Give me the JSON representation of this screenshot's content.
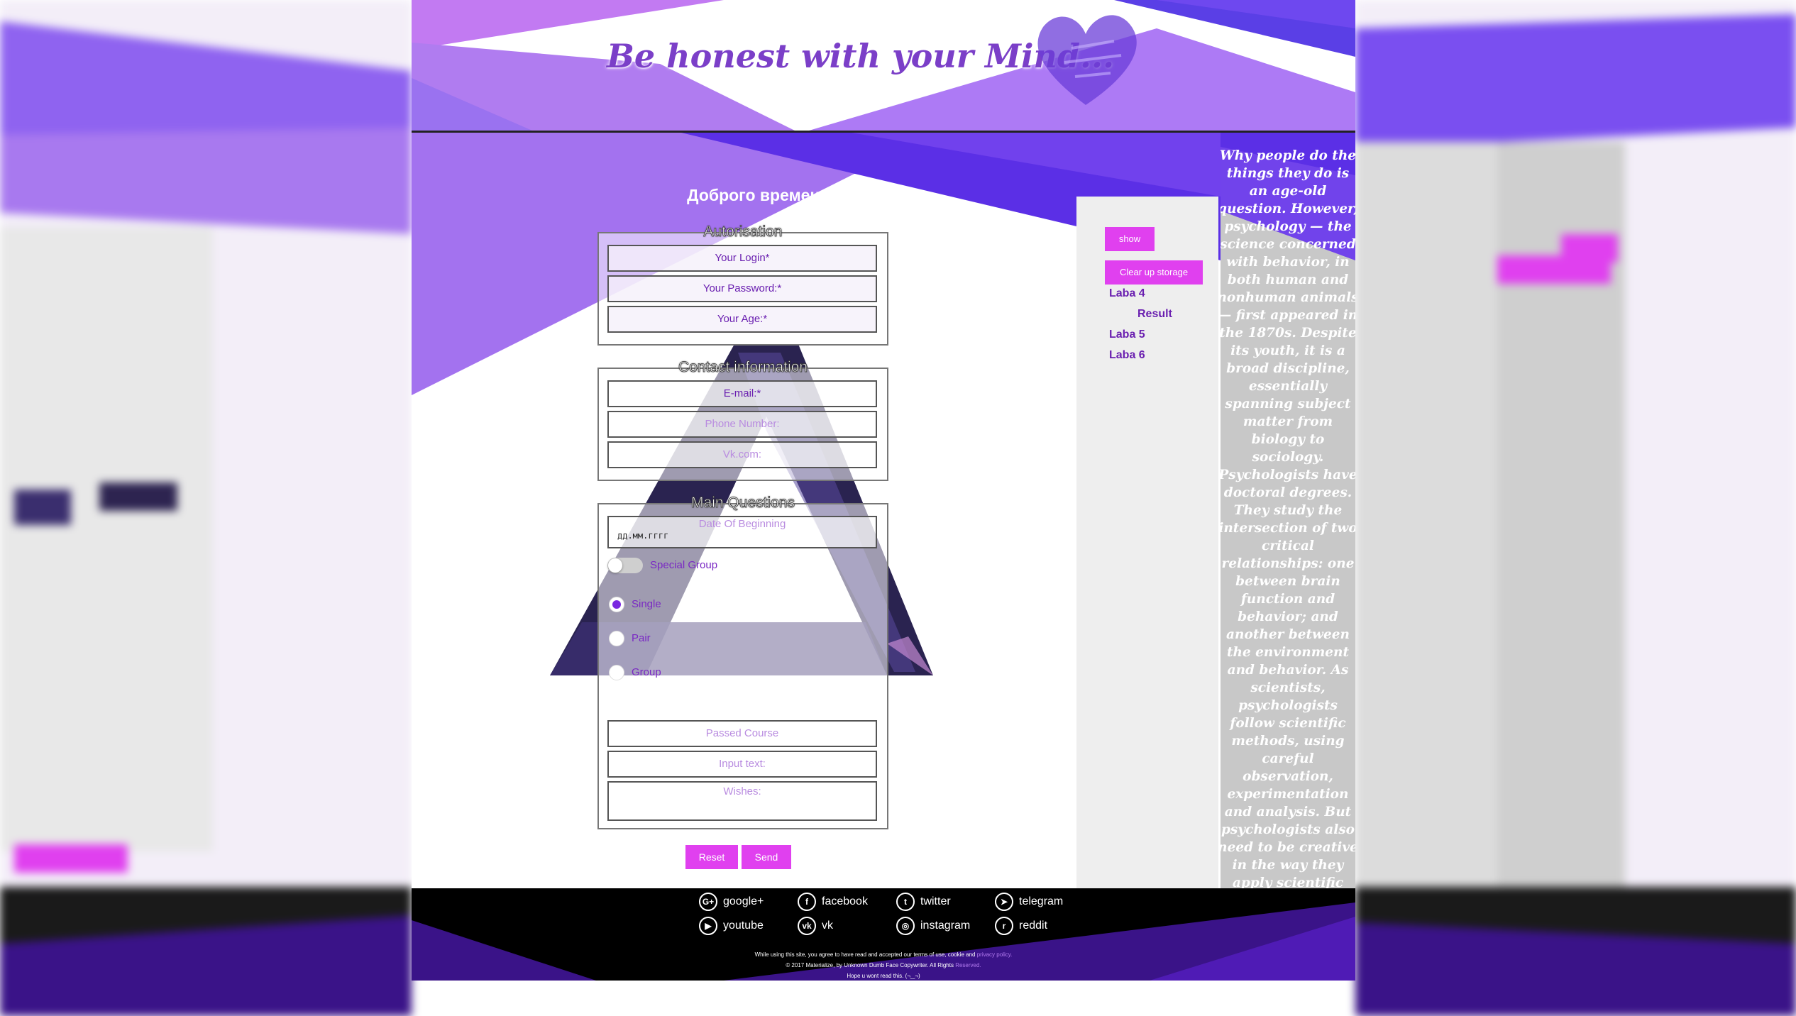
{
  "header": {
    "slogan": "Be honest with your Mind..."
  },
  "greeting": "Доброго времени суток!",
  "forms": {
    "autorisation": {
      "legend": "Autorisation",
      "login_placeholder": "Your Login*",
      "password_placeholder": "Your Password:*",
      "age_placeholder": "Your Age:*"
    },
    "contact": {
      "legend": "Contact information",
      "email_placeholder": "E-mail:*",
      "phone_placeholder": "Phone Number:",
      "vk_placeholder": "Vk.com:"
    },
    "main": {
      "legend": "Main Questions",
      "date_value": "дд.мм.гггг",
      "date_placeholder": "Date Of Beginning",
      "toggle_label": "Special Group",
      "toggle_on": false,
      "radio_options": [
        "Single",
        "Pair",
        "Group"
      ],
      "radio_selected": "Single",
      "passed_course_placeholder": "Passed Course",
      "input_text_placeholder": "Input text:",
      "wishes_placeholder": "Wishes:"
    }
  },
  "buttons": {
    "reset": "Reset",
    "send": "Send"
  },
  "side_panel": {
    "show_button": "show",
    "clear_button": "Clear up storage",
    "links": {
      "laba4": "Laba 4",
      "result": "Result",
      "laba5": "Laba 5",
      "laba6": "Laba 6"
    }
  },
  "quote": "Why people do the things they do is an age-old question. However, psychology — the science concerned with behavior, in both human and nonhuman animals — first appeared in the 1870s. Despite its youth, it is a broad discipline, essentially spanning subject matter from biology to sociology. Psychologists have doctoral degrees. They study the intersection of two critical relationships: one between brain function and behavior; and another between the environment and behavior. As scientists, psychologists follow scientific methods, using careful observation, experimentation and analysis. But psychologists also need to be creative in the way they apply scientific findings.",
  "footer": {
    "social": {
      "google": "google+",
      "facebook": "facebook",
      "twitter": "twitter",
      "telegram": "telegram",
      "youtube": "youtube",
      "vk": "vk",
      "instagram": "instagram",
      "reddit": "reddit"
    },
    "legal_line1_main": "While using this site, you agree to have read and accepted our terms of use, cookie and ",
    "legal_line1_link": "privacy policy.",
    "legal_line2_main": "© 2017 Materialize, by Unknown Dumb Face Copywriter. All Rights ",
    "legal_line2_link": "Reserved.",
    "legal_line3": "Hope u wont read this. (¬‿¬)"
  },
  "colors": {
    "accent_purple": "#7b3fc8",
    "button_magenta": "#e040ef",
    "link_purple": "#6a1fb0",
    "footer_bg": "#000000"
  }
}
